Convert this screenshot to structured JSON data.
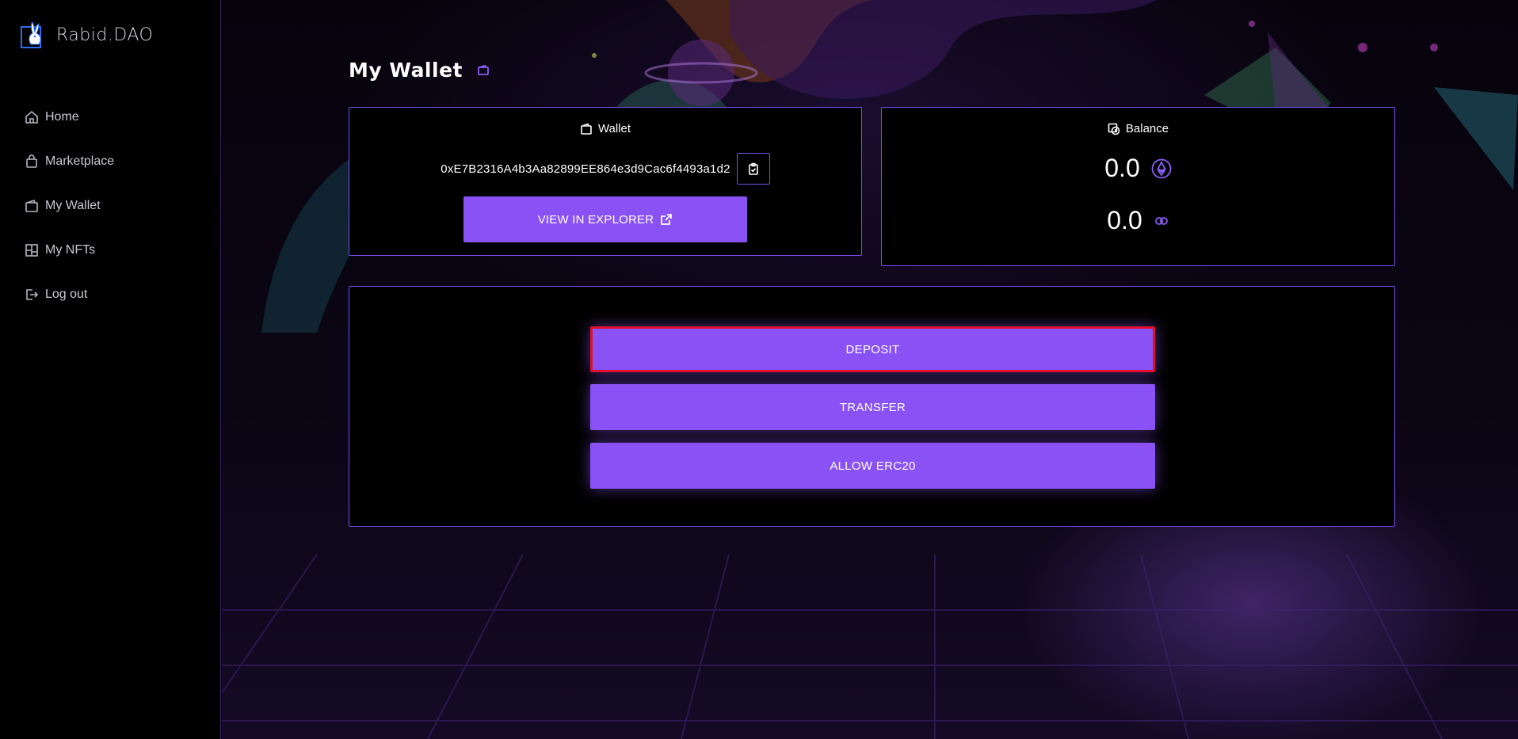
{
  "brand": {
    "name": "Rabid.DAO",
    "logo_icon": "rabbit-logo-icon"
  },
  "sidebar": {
    "items": [
      {
        "label": "Home",
        "icon": "home-icon"
      },
      {
        "label": "Marketplace",
        "icon": "shopping-bag-icon"
      },
      {
        "label": "My Wallet",
        "icon": "wallet-icon"
      },
      {
        "label": "My NFTs",
        "icon": "grid-icon"
      },
      {
        "label": "Log out",
        "icon": "logout-icon"
      }
    ]
  },
  "page": {
    "title": "My Wallet",
    "title_icon": "wallet-icon"
  },
  "wallet_card": {
    "title": "Wallet",
    "address": "0xE7B2316A4b3Aa82899EE864e3d9Cac6f4493a1d2",
    "copy_icon": "clipboard-icon",
    "explorer_label": "VIEW IN EXPLORER",
    "explorer_icon": "external-link-icon"
  },
  "balance_card": {
    "title": "Balance",
    "rows": [
      {
        "value": "0.0",
        "icon": "ethereum-icon"
      },
      {
        "value": "0.0",
        "icon": "chainlink-icon"
      }
    ]
  },
  "actions": {
    "deposit": "DEPOSIT",
    "transfer": "TRANSFER",
    "allow": "ALLOW ERC20"
  },
  "colors": {
    "accent": "#8a52f5",
    "border": "#7a4df0",
    "highlight": "#e0102a",
    "background": "#000000"
  }
}
